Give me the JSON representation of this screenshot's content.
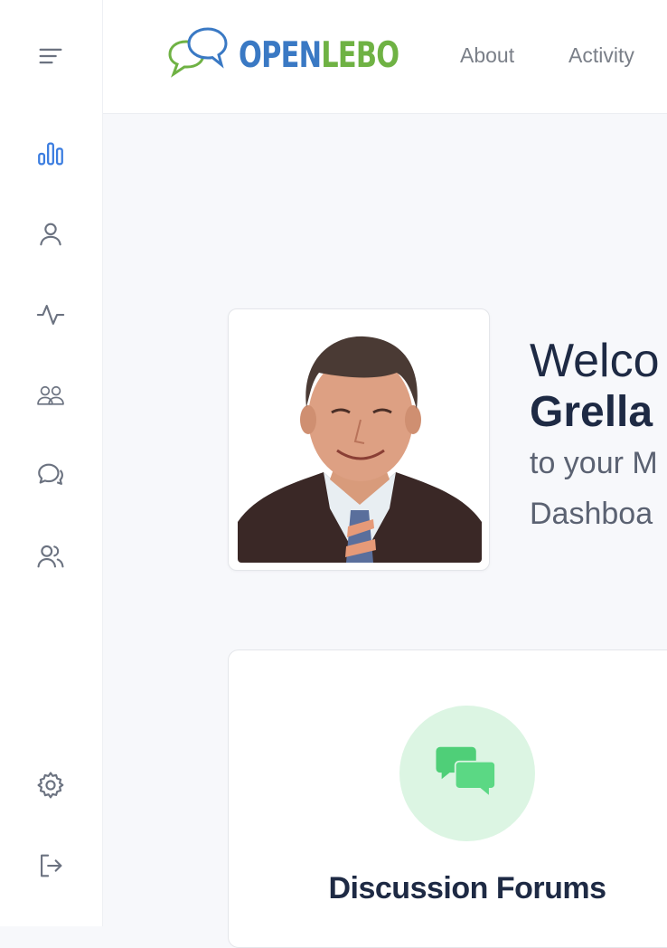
{
  "brand": {
    "logo_open": "OPEN",
    "logo_lebo": "LEBO",
    "colors": {
      "blue": "#3a79c4",
      "green": "#6fb244"
    }
  },
  "nav": {
    "links": [
      {
        "label": "About"
      },
      {
        "label": "Activity"
      }
    ]
  },
  "sidebar": {
    "items": [
      {
        "icon": "menu-icon"
      },
      {
        "icon": "bar-chart-icon",
        "active": true
      },
      {
        "icon": "user-icon"
      },
      {
        "icon": "activity-pulse-icon"
      },
      {
        "icon": "group-icon"
      },
      {
        "icon": "chat-bubbles-icon"
      },
      {
        "icon": "users-icon"
      },
      {
        "icon": "gear-icon"
      },
      {
        "icon": "logout-icon"
      }
    ],
    "active_color": "#3b7de0",
    "icon_color": "#6b7280"
  },
  "welcome": {
    "line1": "Welco",
    "line2": "Grella",
    "line3": "to your M",
    "line4": "Dashboa"
  },
  "cards": {
    "forums": {
      "title": "Discussion Forums",
      "icon": "chat-bubbles-icon",
      "accent": "#4fcf78"
    }
  }
}
